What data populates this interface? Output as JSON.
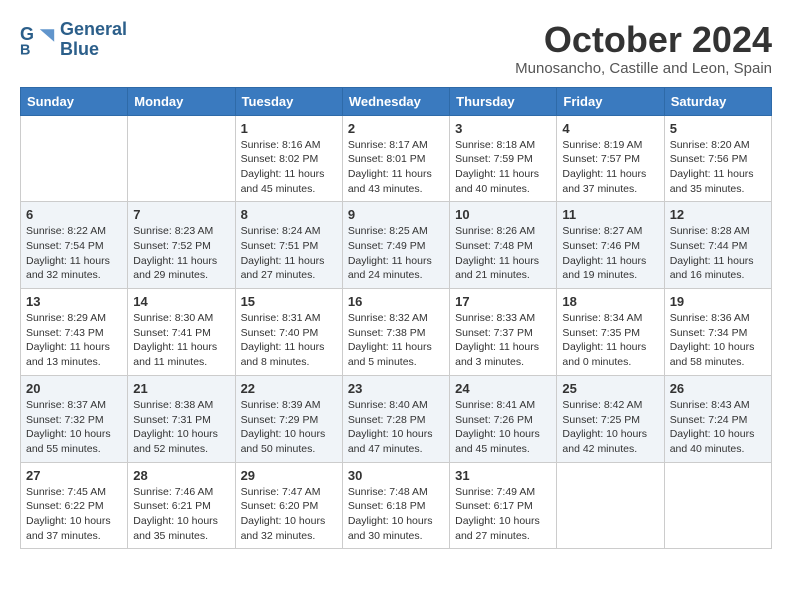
{
  "header": {
    "logo_line1": "General",
    "logo_line2": "Blue",
    "month_title": "October 2024",
    "location": "Munosancho, Castille and Leon, Spain"
  },
  "days_of_week": [
    "Sunday",
    "Monday",
    "Tuesday",
    "Wednesday",
    "Thursday",
    "Friday",
    "Saturday"
  ],
  "weeks": [
    [
      {
        "num": "",
        "sunrise": "",
        "sunset": "",
        "daylight": ""
      },
      {
        "num": "",
        "sunrise": "",
        "sunset": "",
        "daylight": ""
      },
      {
        "num": "1",
        "sunrise": "Sunrise: 8:16 AM",
        "sunset": "Sunset: 8:02 PM",
        "daylight": "Daylight: 11 hours and 45 minutes."
      },
      {
        "num": "2",
        "sunrise": "Sunrise: 8:17 AM",
        "sunset": "Sunset: 8:01 PM",
        "daylight": "Daylight: 11 hours and 43 minutes."
      },
      {
        "num": "3",
        "sunrise": "Sunrise: 8:18 AM",
        "sunset": "Sunset: 7:59 PM",
        "daylight": "Daylight: 11 hours and 40 minutes."
      },
      {
        "num": "4",
        "sunrise": "Sunrise: 8:19 AM",
        "sunset": "Sunset: 7:57 PM",
        "daylight": "Daylight: 11 hours and 37 minutes."
      },
      {
        "num": "5",
        "sunrise": "Sunrise: 8:20 AM",
        "sunset": "Sunset: 7:56 PM",
        "daylight": "Daylight: 11 hours and 35 minutes."
      }
    ],
    [
      {
        "num": "6",
        "sunrise": "Sunrise: 8:22 AM",
        "sunset": "Sunset: 7:54 PM",
        "daylight": "Daylight: 11 hours and 32 minutes."
      },
      {
        "num": "7",
        "sunrise": "Sunrise: 8:23 AM",
        "sunset": "Sunset: 7:52 PM",
        "daylight": "Daylight: 11 hours and 29 minutes."
      },
      {
        "num": "8",
        "sunrise": "Sunrise: 8:24 AM",
        "sunset": "Sunset: 7:51 PM",
        "daylight": "Daylight: 11 hours and 27 minutes."
      },
      {
        "num": "9",
        "sunrise": "Sunrise: 8:25 AM",
        "sunset": "Sunset: 7:49 PM",
        "daylight": "Daylight: 11 hours and 24 minutes."
      },
      {
        "num": "10",
        "sunrise": "Sunrise: 8:26 AM",
        "sunset": "Sunset: 7:48 PM",
        "daylight": "Daylight: 11 hours and 21 minutes."
      },
      {
        "num": "11",
        "sunrise": "Sunrise: 8:27 AM",
        "sunset": "Sunset: 7:46 PM",
        "daylight": "Daylight: 11 hours and 19 minutes."
      },
      {
        "num": "12",
        "sunrise": "Sunrise: 8:28 AM",
        "sunset": "Sunset: 7:44 PM",
        "daylight": "Daylight: 11 hours and 16 minutes."
      }
    ],
    [
      {
        "num": "13",
        "sunrise": "Sunrise: 8:29 AM",
        "sunset": "Sunset: 7:43 PM",
        "daylight": "Daylight: 11 hours and 13 minutes."
      },
      {
        "num": "14",
        "sunrise": "Sunrise: 8:30 AM",
        "sunset": "Sunset: 7:41 PM",
        "daylight": "Daylight: 11 hours and 11 minutes."
      },
      {
        "num": "15",
        "sunrise": "Sunrise: 8:31 AM",
        "sunset": "Sunset: 7:40 PM",
        "daylight": "Daylight: 11 hours and 8 minutes."
      },
      {
        "num": "16",
        "sunrise": "Sunrise: 8:32 AM",
        "sunset": "Sunset: 7:38 PM",
        "daylight": "Daylight: 11 hours and 5 minutes."
      },
      {
        "num": "17",
        "sunrise": "Sunrise: 8:33 AM",
        "sunset": "Sunset: 7:37 PM",
        "daylight": "Daylight: 11 hours and 3 minutes."
      },
      {
        "num": "18",
        "sunrise": "Sunrise: 8:34 AM",
        "sunset": "Sunset: 7:35 PM",
        "daylight": "Daylight: 11 hours and 0 minutes."
      },
      {
        "num": "19",
        "sunrise": "Sunrise: 8:36 AM",
        "sunset": "Sunset: 7:34 PM",
        "daylight": "Daylight: 10 hours and 58 minutes."
      }
    ],
    [
      {
        "num": "20",
        "sunrise": "Sunrise: 8:37 AM",
        "sunset": "Sunset: 7:32 PM",
        "daylight": "Daylight: 10 hours and 55 minutes."
      },
      {
        "num": "21",
        "sunrise": "Sunrise: 8:38 AM",
        "sunset": "Sunset: 7:31 PM",
        "daylight": "Daylight: 10 hours and 52 minutes."
      },
      {
        "num": "22",
        "sunrise": "Sunrise: 8:39 AM",
        "sunset": "Sunset: 7:29 PM",
        "daylight": "Daylight: 10 hours and 50 minutes."
      },
      {
        "num": "23",
        "sunrise": "Sunrise: 8:40 AM",
        "sunset": "Sunset: 7:28 PM",
        "daylight": "Daylight: 10 hours and 47 minutes."
      },
      {
        "num": "24",
        "sunrise": "Sunrise: 8:41 AM",
        "sunset": "Sunset: 7:26 PM",
        "daylight": "Daylight: 10 hours and 45 minutes."
      },
      {
        "num": "25",
        "sunrise": "Sunrise: 8:42 AM",
        "sunset": "Sunset: 7:25 PM",
        "daylight": "Daylight: 10 hours and 42 minutes."
      },
      {
        "num": "26",
        "sunrise": "Sunrise: 8:43 AM",
        "sunset": "Sunset: 7:24 PM",
        "daylight": "Daylight: 10 hours and 40 minutes."
      }
    ],
    [
      {
        "num": "27",
        "sunrise": "Sunrise: 7:45 AM",
        "sunset": "Sunset: 6:22 PM",
        "daylight": "Daylight: 10 hours and 37 minutes."
      },
      {
        "num": "28",
        "sunrise": "Sunrise: 7:46 AM",
        "sunset": "Sunset: 6:21 PM",
        "daylight": "Daylight: 10 hours and 35 minutes."
      },
      {
        "num": "29",
        "sunrise": "Sunrise: 7:47 AM",
        "sunset": "Sunset: 6:20 PM",
        "daylight": "Daylight: 10 hours and 32 minutes."
      },
      {
        "num": "30",
        "sunrise": "Sunrise: 7:48 AM",
        "sunset": "Sunset: 6:18 PM",
        "daylight": "Daylight: 10 hours and 30 minutes."
      },
      {
        "num": "31",
        "sunrise": "Sunrise: 7:49 AM",
        "sunset": "Sunset: 6:17 PM",
        "daylight": "Daylight: 10 hours and 27 minutes."
      },
      {
        "num": "",
        "sunrise": "",
        "sunset": "",
        "daylight": ""
      },
      {
        "num": "",
        "sunrise": "",
        "sunset": "",
        "daylight": ""
      }
    ]
  ]
}
